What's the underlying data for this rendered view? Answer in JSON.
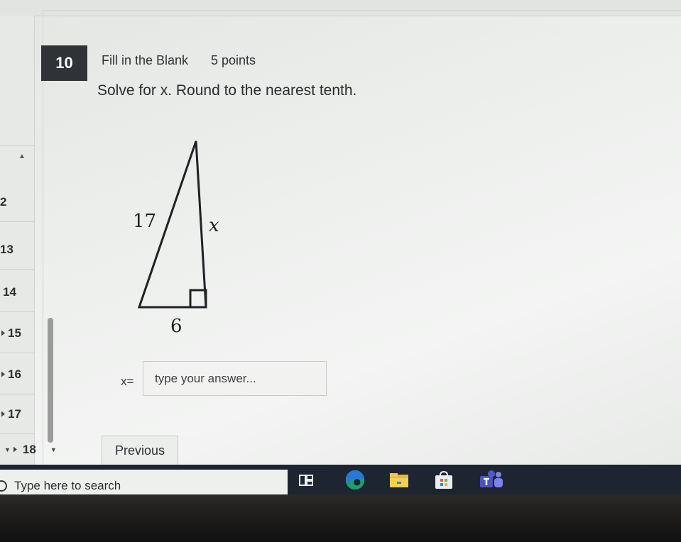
{
  "question_nav": {
    "items": [
      {
        "label": "2"
      },
      {
        "label": "13"
      },
      {
        "label": "14"
      },
      {
        "label": "15"
      },
      {
        "label": "16"
      },
      {
        "label": "17"
      },
      {
        "label": "18"
      }
    ]
  },
  "question": {
    "number": "10",
    "type": "Fill in the Blank",
    "points": "5 points",
    "prompt": "Solve for x. Round to the nearest tenth.",
    "figure": {
      "hypotenuse_label": "17",
      "side_label": "x",
      "base_label": "6"
    },
    "answer_label": "x=",
    "answer_placeholder": "type your answer...",
    "answer_value": ""
  },
  "footer": {
    "previous_label": "Previous"
  },
  "taskbar": {
    "search_placeholder": "Type here to search",
    "icons": [
      "task-view-icon",
      "edge-icon",
      "file-explorer-icon",
      "store-icon",
      "teams-icon"
    ],
    "accent_color": "#7fb7e8"
  }
}
